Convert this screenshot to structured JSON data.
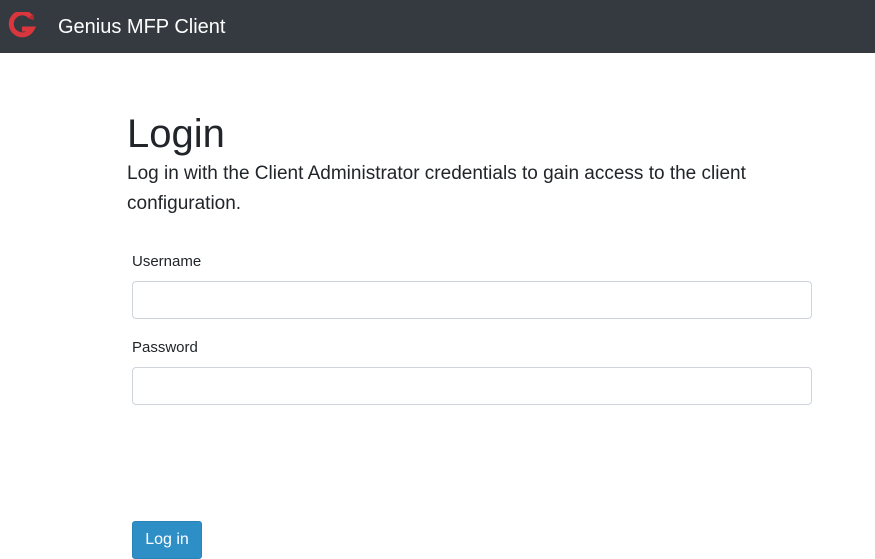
{
  "navbar": {
    "brand_logo": "genius-g-logo",
    "brand_title": "Genius MFP Client",
    "logo_color": "#d9363e",
    "background_color": "#343a40"
  },
  "login": {
    "title": "Login",
    "description": "Log in with the Client Administrator credentials to gain access to the client configuration.",
    "username_label": "Username",
    "username_value": "",
    "password_label": "Password",
    "password_value": "",
    "submit_label": "Log in",
    "button_color": "#2e8fc7"
  }
}
